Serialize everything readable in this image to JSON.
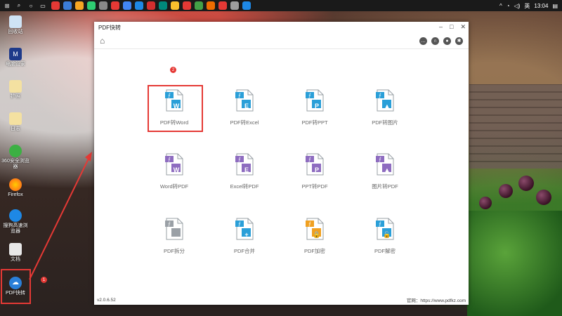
{
  "taskbar": {
    "time": "13:04",
    "ime": "英"
  },
  "desktop": {
    "icons": [
      {
        "label": "回收站"
      },
      {
        "label": "电脑管家"
      },
      {
        "label": "护照"
      },
      {
        "label": "日志"
      },
      {
        "label": "360安全浏览器"
      },
      {
        "label": "Firefox"
      },
      {
        "label": "搜狗高速浏览器"
      },
      {
        "label": "文档"
      },
      {
        "label": "PDF快转"
      }
    ],
    "step1_badge": "1"
  },
  "window": {
    "title": "PDF快转",
    "version": "v2.0.6.52",
    "website": "官网：https://www.pdfkz.com",
    "step2_badge": "2"
  },
  "tools": [
    {
      "label": "PDF转Word",
      "letter": "W",
      "color": "#2a9fd8"
    },
    {
      "label": "PDF转Excel",
      "letter": "E",
      "color": "#2a9fd8"
    },
    {
      "label": "PDF转PPT",
      "letter": "P",
      "color": "#2a9fd8"
    },
    {
      "label": "PDF转图片",
      "letter": "▲",
      "color": "#2a9fd8"
    },
    {
      "label": "Word转PDF",
      "letter": "W",
      "color": "#8e6cc0"
    },
    {
      "label": "Excel转PDF",
      "letter": "E",
      "color": "#8e6cc0"
    },
    {
      "label": "PPT转PDF",
      "letter": "P",
      "color": "#8e6cc0"
    },
    {
      "label": "图片转PDF",
      "letter": "▲",
      "color": "#8e6cc0"
    },
    {
      "label": "PDF拆分",
      "letter": "",
      "color": "#9aa0a6"
    },
    {
      "label": "PDF合并",
      "letter": "+",
      "color": "#2a9fd8"
    },
    {
      "label": "PDF加密",
      "letter": "🔒",
      "color": "#f0a020"
    },
    {
      "label": "PDF解密",
      "letter": "🔓",
      "color": "#2a9fd8"
    }
  ],
  "colors": {
    "highlight": "#e53935",
    "pdf_blue": "#2a9fd8"
  }
}
